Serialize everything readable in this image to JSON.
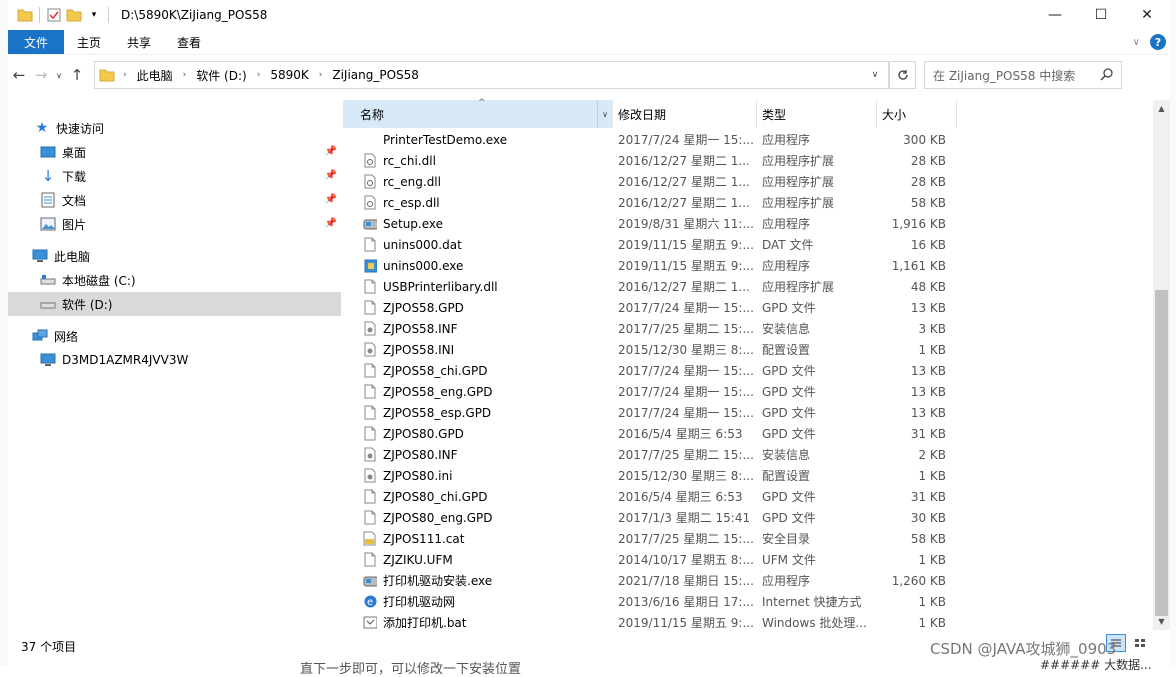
{
  "titlebar": {
    "path": "D:\\5890K\\ZiJiang_POS58",
    "icons": [
      "folder-icon",
      "properties-icon",
      "new-folder-icon",
      "customize-dropdown-icon"
    ],
    "minimize": "—",
    "maximize": "☐",
    "close": "✕"
  },
  "ribbon": {
    "file": "文件",
    "tabs": [
      "主页",
      "共享",
      "查看"
    ]
  },
  "address": {
    "crumbs": [
      "此电脑",
      "软件 (D:)",
      "5890K",
      "ZiJiang_POS58"
    ],
    "search_placeholder": "在 ZiJiang_POS58 中搜索"
  },
  "nav": {
    "quick_access": "快速访问",
    "quick_items": [
      {
        "label": "桌面",
        "icon": "desktop-icon"
      },
      {
        "label": "下载",
        "icon": "download-icon"
      },
      {
        "label": "文档",
        "icon": "documents-icon"
      },
      {
        "label": "图片",
        "icon": "pictures-icon"
      }
    ],
    "this_pc": "此电脑",
    "drives": [
      {
        "label": "本地磁盘 (C:)",
        "icon": "drive-c-icon"
      },
      {
        "label": "软件 (D:)",
        "icon": "drive-d-icon"
      }
    ],
    "network": "网络",
    "computer": "D3MD1AZMR4JVV3W"
  },
  "columns": {
    "name": "名称",
    "date": "修改日期",
    "type": "类型",
    "size": "大小"
  },
  "files": [
    {
      "name": "PrinterTestDemo.exe",
      "date": "2017/7/24 星期一 15:...",
      "type": "应用程序",
      "size": "300 KB",
      "icon": "blank"
    },
    {
      "name": "rc_chi.dll",
      "date": "2016/12/27 星期二 1...",
      "type": "应用程序扩展",
      "size": "28 KB",
      "icon": "dll"
    },
    {
      "name": "rc_eng.dll",
      "date": "2016/12/27 星期二 1...",
      "type": "应用程序扩展",
      "size": "28 KB",
      "icon": "dll"
    },
    {
      "name": "rc_esp.dll",
      "date": "2016/12/27 星期二 1...",
      "type": "应用程序扩展",
      "size": "58 KB",
      "icon": "dll"
    },
    {
      "name": "Setup.exe",
      "date": "2019/8/31 星期六 11:...",
      "type": "应用程序",
      "size": "1,916 KB",
      "icon": "setup"
    },
    {
      "name": "unins000.dat",
      "date": "2019/11/15 星期五 9:...",
      "type": "DAT 文件",
      "size": "16 KB",
      "icon": "doc"
    },
    {
      "name": "unins000.exe",
      "date": "2019/11/15 星期五 9:...",
      "type": "应用程序",
      "size": "1,161 KB",
      "icon": "installer"
    },
    {
      "name": "USBPrinterlibary.dll",
      "date": "2016/12/27 星期二 1...",
      "type": "应用程序扩展",
      "size": "48 KB",
      "icon": "doc"
    },
    {
      "name": "ZJPOS58.GPD",
      "date": "2017/7/24 星期一 15:...",
      "type": "GPD 文件",
      "size": "13 KB",
      "icon": "doc"
    },
    {
      "name": "ZJPOS58.INF",
      "date": "2017/7/25 星期二 15:...",
      "type": "安装信息",
      "size": "3 KB",
      "icon": "inf"
    },
    {
      "name": "ZJPOS58.INI",
      "date": "2015/12/30 星期三 8:...",
      "type": "配置设置",
      "size": "1 KB",
      "icon": "inf"
    },
    {
      "name": "ZJPOS58_chi.GPD",
      "date": "2017/7/24 星期一 15:...",
      "type": "GPD 文件",
      "size": "13 KB",
      "icon": "doc"
    },
    {
      "name": "ZJPOS58_eng.GPD",
      "date": "2017/7/24 星期一 15:...",
      "type": "GPD 文件",
      "size": "13 KB",
      "icon": "doc"
    },
    {
      "name": "ZJPOS58_esp.GPD",
      "date": "2017/7/24 星期一 15:...",
      "type": "GPD 文件",
      "size": "13 KB",
      "icon": "doc"
    },
    {
      "name": "ZJPOS80.GPD",
      "date": "2016/5/4 星期三 6:53",
      "type": "GPD 文件",
      "size": "31 KB",
      "icon": "doc"
    },
    {
      "name": "ZJPOS80.INF",
      "date": "2017/7/25 星期二 15:...",
      "type": "安装信息",
      "size": "2 KB",
      "icon": "inf"
    },
    {
      "name": "ZJPOS80.ini",
      "date": "2015/12/30 星期三 8:...",
      "type": "配置设置",
      "size": "1 KB",
      "icon": "inf"
    },
    {
      "name": "ZJPOS80_chi.GPD",
      "date": "2016/5/4 星期三 6:53",
      "type": "GPD 文件",
      "size": "31 KB",
      "icon": "doc"
    },
    {
      "name": "ZJPOS80_eng.GPD",
      "date": "2017/1/3 星期二 15:41",
      "type": "GPD 文件",
      "size": "30 KB",
      "icon": "doc"
    },
    {
      "name": "ZJPOS111.cat",
      "date": "2017/7/25 星期二 15:...",
      "type": "安全目录",
      "size": "58 KB",
      "icon": "cat"
    },
    {
      "name": "ZJZIKU.UFM",
      "date": "2014/10/17 星期五 8:...",
      "type": "UFM 文件",
      "size": "1 KB",
      "icon": "doc"
    },
    {
      "name": "打印机驱动安装.exe",
      "date": "2021/7/18 星期日 15:...",
      "type": "应用程序",
      "size": "1,260 KB",
      "icon": "setup"
    },
    {
      "name": "打印机驱动网",
      "date": "2013/6/16 星期日 17:...",
      "type": "Internet 快捷方式",
      "size": "1 KB",
      "icon": "ie"
    },
    {
      "name": "添加打印机.bat",
      "date": "2019/11/15 星期五 9:...",
      "type": "Windows 批处理...",
      "size": "1 KB",
      "icon": "bat"
    }
  ],
  "status": "37 个项目",
  "watermark": "CSDN @JAVA攻城狮_0903",
  "background_text": {
    "bottom": "直下一步即可，可以修改一下安装位置",
    "bottom_right": "###### 大数据..."
  },
  "colors": {
    "accent": "#1a73c7",
    "header_selected": "#d8e9f7",
    "nav_selected": "#d9d9d9"
  }
}
